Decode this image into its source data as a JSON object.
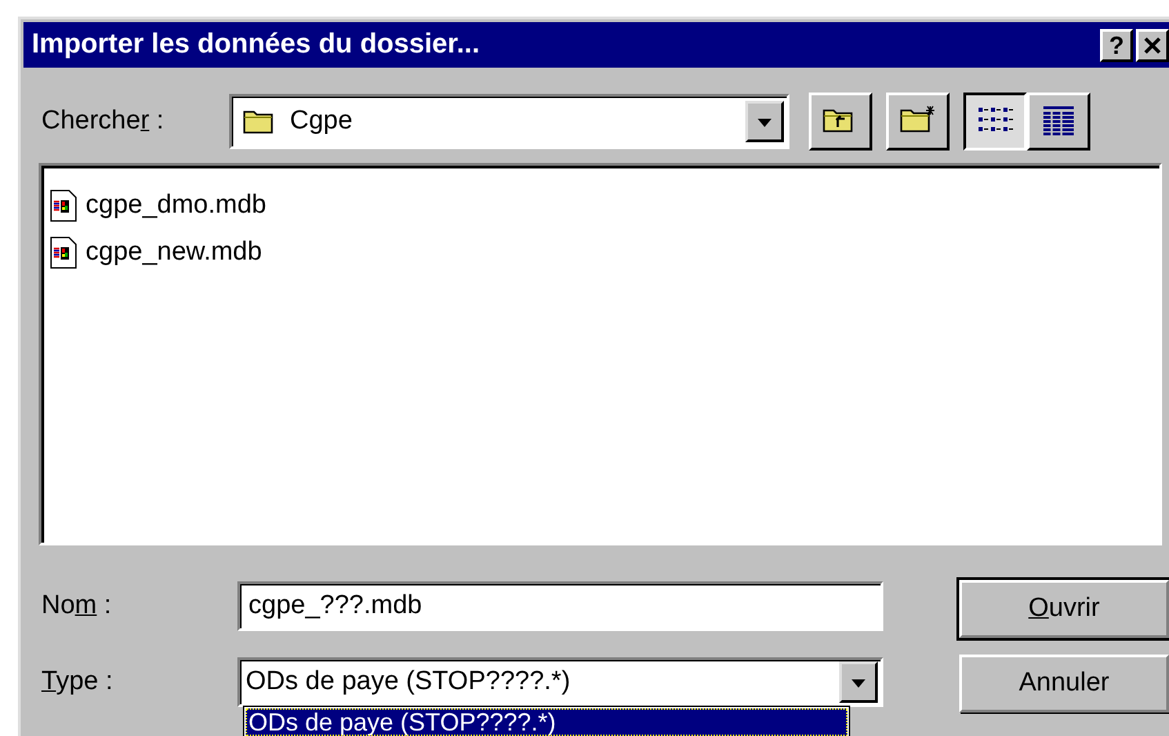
{
  "window": {
    "title": "Importer les données du dossier...",
    "help_button": "?"
  },
  "look_in": {
    "label": {
      "before": "Cherche",
      "mnemonic": "r",
      "after": " :"
    },
    "value": "Cgpe"
  },
  "toolbar": [
    {
      "kind": "up"
    },
    {
      "kind": "newfolder"
    },
    {
      "kind": "list",
      "selected": true
    },
    {
      "kind": "details",
      "selected": false
    }
  ],
  "files": [
    {
      "name": "cgpe_dmo.mdb",
      "selected": false
    },
    {
      "name": "cgpe_new.mdb",
      "selected": false
    }
  ],
  "file_name": {
    "label": {
      "before": "No",
      "mnemonic": "m",
      "after": " :"
    },
    "value": "cgpe_???.mdb"
  },
  "file_type": {
    "label": {
      "mnemonic": "T",
      "after": "ype :"
    },
    "value": "ODs de paye (STOP????.*)",
    "expanded": true,
    "options": [
      {
        "text": "ODs de paye (STOP????.*)",
        "selected": true
      }
    ]
  },
  "buttons": [
    {
      "label": {
        "mnemonic": "O",
        "after": "uvrir"
      },
      "default": true
    },
    {
      "label": {
        "before": "Annuler"
      },
      "default": false
    }
  ]
}
